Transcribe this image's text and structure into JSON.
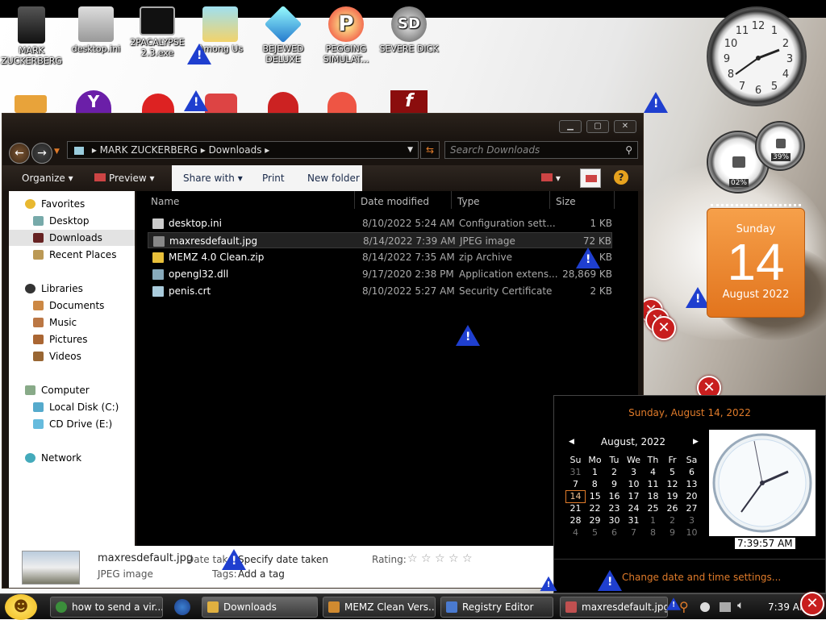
{
  "desktop_icons": [
    {
      "label": "MARK ZUCKERBERG",
      "icon": "folder-person-icon"
    },
    {
      "label": "desktop.ini",
      "icon": "config-file-icon"
    },
    {
      "label": "2PACALYPSE 2.3.exe",
      "icon": "console-app-icon"
    },
    {
      "label": "Among Us",
      "icon": "folder-icon"
    },
    {
      "label": "BEJEWED DELUXE",
      "icon": "gem-icon"
    },
    {
      "label": "PEGGING SIMULAT...",
      "icon": "p-logo-icon"
    },
    {
      "label": "SEVERE DICK",
      "icon": "sd-gear-icon"
    }
  ],
  "explorer": {
    "breadcrumb": [
      "MARK ZUCKERBERG",
      "Downloads"
    ],
    "search_placeholder": "Search Downloads",
    "toolbar": {
      "organize": "Organize",
      "preview": "Preview",
      "share_with": "Share with",
      "print": "Print",
      "new_folder": "New folder"
    },
    "nav": {
      "favorites": "Favorites",
      "favorites_items": [
        "Desktop",
        "Downloads",
        "Recent Places"
      ],
      "libraries": "Libraries",
      "libraries_items": [
        "Documents",
        "Music",
        "Pictures",
        "Videos"
      ],
      "computer": "Computer",
      "computer_items": [
        "Local Disk (C:)",
        "CD Drive (E:)"
      ],
      "network": "Network",
      "selected": "Downloads"
    },
    "columns": {
      "name": "Name",
      "date": "Date modified",
      "type": "Type",
      "size": "Size"
    },
    "files": [
      {
        "name": "desktop.ini",
        "date": "8/10/2022 5:24 AM",
        "type": "Configuration sett...",
        "size": "1 KB",
        "icon": "config-file-icon"
      },
      {
        "name": "maxresdefault.jpg",
        "date": "8/14/2022 7:39 AM",
        "type": "JPEG image",
        "size": "72 KB",
        "icon": "image-file-icon"
      },
      {
        "name": "MEMZ 4.0 Clean.zip",
        "date": "8/14/2022 7:35 AM",
        "type": "zip Archive",
        "size": "KB",
        "icon": "zip-file-icon"
      },
      {
        "name": "opengl32.dll",
        "date": "9/17/2020 2:38 PM",
        "type": "Application extens...",
        "size": "28,869 KB",
        "icon": "dll-file-icon"
      },
      {
        "name": "penis.crt",
        "date": "8/10/2022 5:27 AM",
        "type": "Security Certificate",
        "size": "2 KB",
        "icon": "certificate-icon"
      }
    ],
    "details": {
      "filename": "maxresdefault.jpg",
      "filetype": "JPEG image",
      "date_taken_label": "Date take",
      "date_taken_value": "Specify date taken",
      "rating_label": "Rating:",
      "rating_stars": "☆ ☆ ☆ ☆ ☆",
      "tags_label": "Tags:",
      "tags_value": "Add a tag"
    }
  },
  "gadgets": {
    "cpu_percent": "02%",
    "mem_percent": "39%",
    "calendar_day_name": "Sunday",
    "calendar_day_num": "14",
    "calendar_month_year": "August 2022"
  },
  "calendar_popup": {
    "header_date": "Sunday, August 14, 2022",
    "month_label": "August, 2022",
    "weekdays": [
      "Su",
      "Mo",
      "Tu",
      "We",
      "Th",
      "Fr",
      "Sa"
    ],
    "weeks": [
      [
        "31",
        "1",
        "2",
        "3",
        "4",
        "5",
        "6"
      ],
      [
        "7",
        "8",
        "9",
        "10",
        "11",
        "12",
        "13"
      ],
      [
        "14",
        "15",
        "16",
        "17",
        "18",
        "19",
        "20"
      ],
      [
        "21",
        "22",
        "23",
        "24",
        "25",
        "26",
        "27"
      ],
      [
        "28",
        "29",
        "30",
        "31",
        "1",
        "2",
        "3"
      ],
      [
        "4",
        "5",
        "6",
        "7",
        "8",
        "9",
        "10"
      ]
    ],
    "today": "14",
    "digital_time": "7:39:57 AM",
    "settings_link": "Change date and time settings..."
  },
  "taskbar": {
    "tasks": [
      {
        "label": "how to send a vir...",
        "icon": "chrome-icon",
        "color": "#3b8f3b"
      },
      {
        "label": "Downloads",
        "icon": "explorer-folder-icon",
        "color": "#e0b040"
      },
      {
        "label": "MEMZ Clean Vers...",
        "icon": "folder-icon",
        "color": "#d08a30"
      },
      {
        "label": "Registry Editor",
        "icon": "registry-icon",
        "color": "#4a7ad0"
      },
      {
        "label": "maxresdefault.jpg...",
        "icon": "image-viewer-icon",
        "color": "#c05050"
      }
    ],
    "clock": "7:39 AM"
  },
  "colors": {
    "accent_orange": "#e07b2a",
    "warning_blue": "#1f3fcf",
    "error_red": "#c81e1e"
  }
}
